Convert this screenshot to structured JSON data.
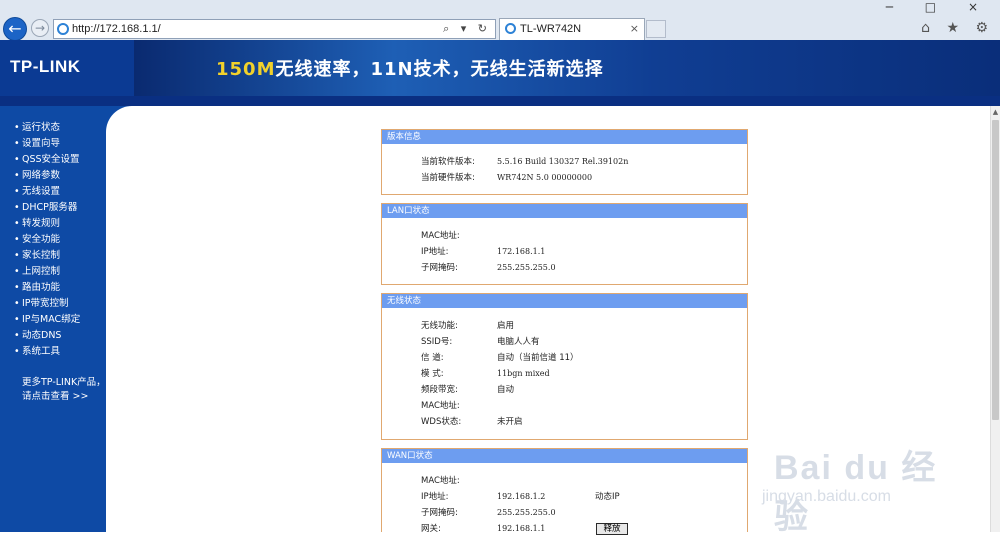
{
  "browser": {
    "url": "http://172.168.1.1/",
    "url_icons": "⌕ ▾ ↻",
    "tab_title": "TL-WR742N",
    "tab_close": "×",
    "back_icon": "←",
    "forward_icon": "→",
    "window_controls": "─ □ ×",
    "tool_icons": "⌂ ★ ⚙"
  },
  "banner": {
    "logo": "TP-LINK",
    "slogan_highlight": "150M",
    "slogan_rest": "无线速率，11N技术，无线生活新选择"
  },
  "sidebar": {
    "items": [
      {
        "label": "运行状态"
      },
      {
        "label": "设置向导"
      },
      {
        "label": "QSS安全设置"
      },
      {
        "label": "网络参数"
      },
      {
        "label": "无线设置"
      },
      {
        "label": "DHCP服务器"
      },
      {
        "label": "转发规则"
      },
      {
        "label": "安全功能"
      },
      {
        "label": "家长控制"
      },
      {
        "label": "上网控制"
      },
      {
        "label": "路由功能"
      },
      {
        "label": "IP带宽控制"
      },
      {
        "label": "IP与MAC绑定"
      },
      {
        "label": "动态DNS"
      },
      {
        "label": "系统工具"
      }
    ],
    "more_line1": "更多TP-LINK产品，",
    "more_line2": "请点击查看 >>"
  },
  "version": {
    "title": "版本信息",
    "sw_label": "当前软件版本:",
    "sw_value": "5.5.16 Build 130327 Rel.39102n",
    "hw_label": "当前硬件版本:",
    "hw_value": "WR742N 5.0 00000000"
  },
  "lan": {
    "title": "LAN口状态",
    "mac_label": "MAC地址:",
    "mac_value": "",
    "ip_label": "IP地址:",
    "ip_value": "172.168.1.1",
    "mask_label": "子网掩码:",
    "mask_value": "255.255.255.0"
  },
  "wireless": {
    "title": "无线状态",
    "func_label": "无线功能:",
    "func_value": "启用",
    "ssid_label": "SSID号:",
    "ssid_value": "电脑人人有",
    "channel_label": "信 道:",
    "channel_value": "自动（当前信道 11）",
    "mode_label": "模 式:",
    "mode_value": "11bgn mixed",
    "bw_label": "频段带宽:",
    "bw_value": "自动",
    "mac_label": "MAC地址:",
    "mac_value": "",
    "wds_label": "WDS状态:",
    "wds_value": "未开启"
  },
  "wan": {
    "title": "WAN口状态",
    "mac_label": "MAC地址:",
    "mac_value": "",
    "ip_label": "IP地址:",
    "ip_value": "192.168.1.2",
    "ip_type": "动态IP",
    "mask_label": "子网掩码:",
    "mask_value": "255.255.255.0",
    "gw_label": "网关:",
    "gw_value": "192.168.1.1",
    "release_button": "释放"
  },
  "watermark": {
    "logo": "Bai du 经验",
    "url": "jingyan.baidu.com"
  }
}
